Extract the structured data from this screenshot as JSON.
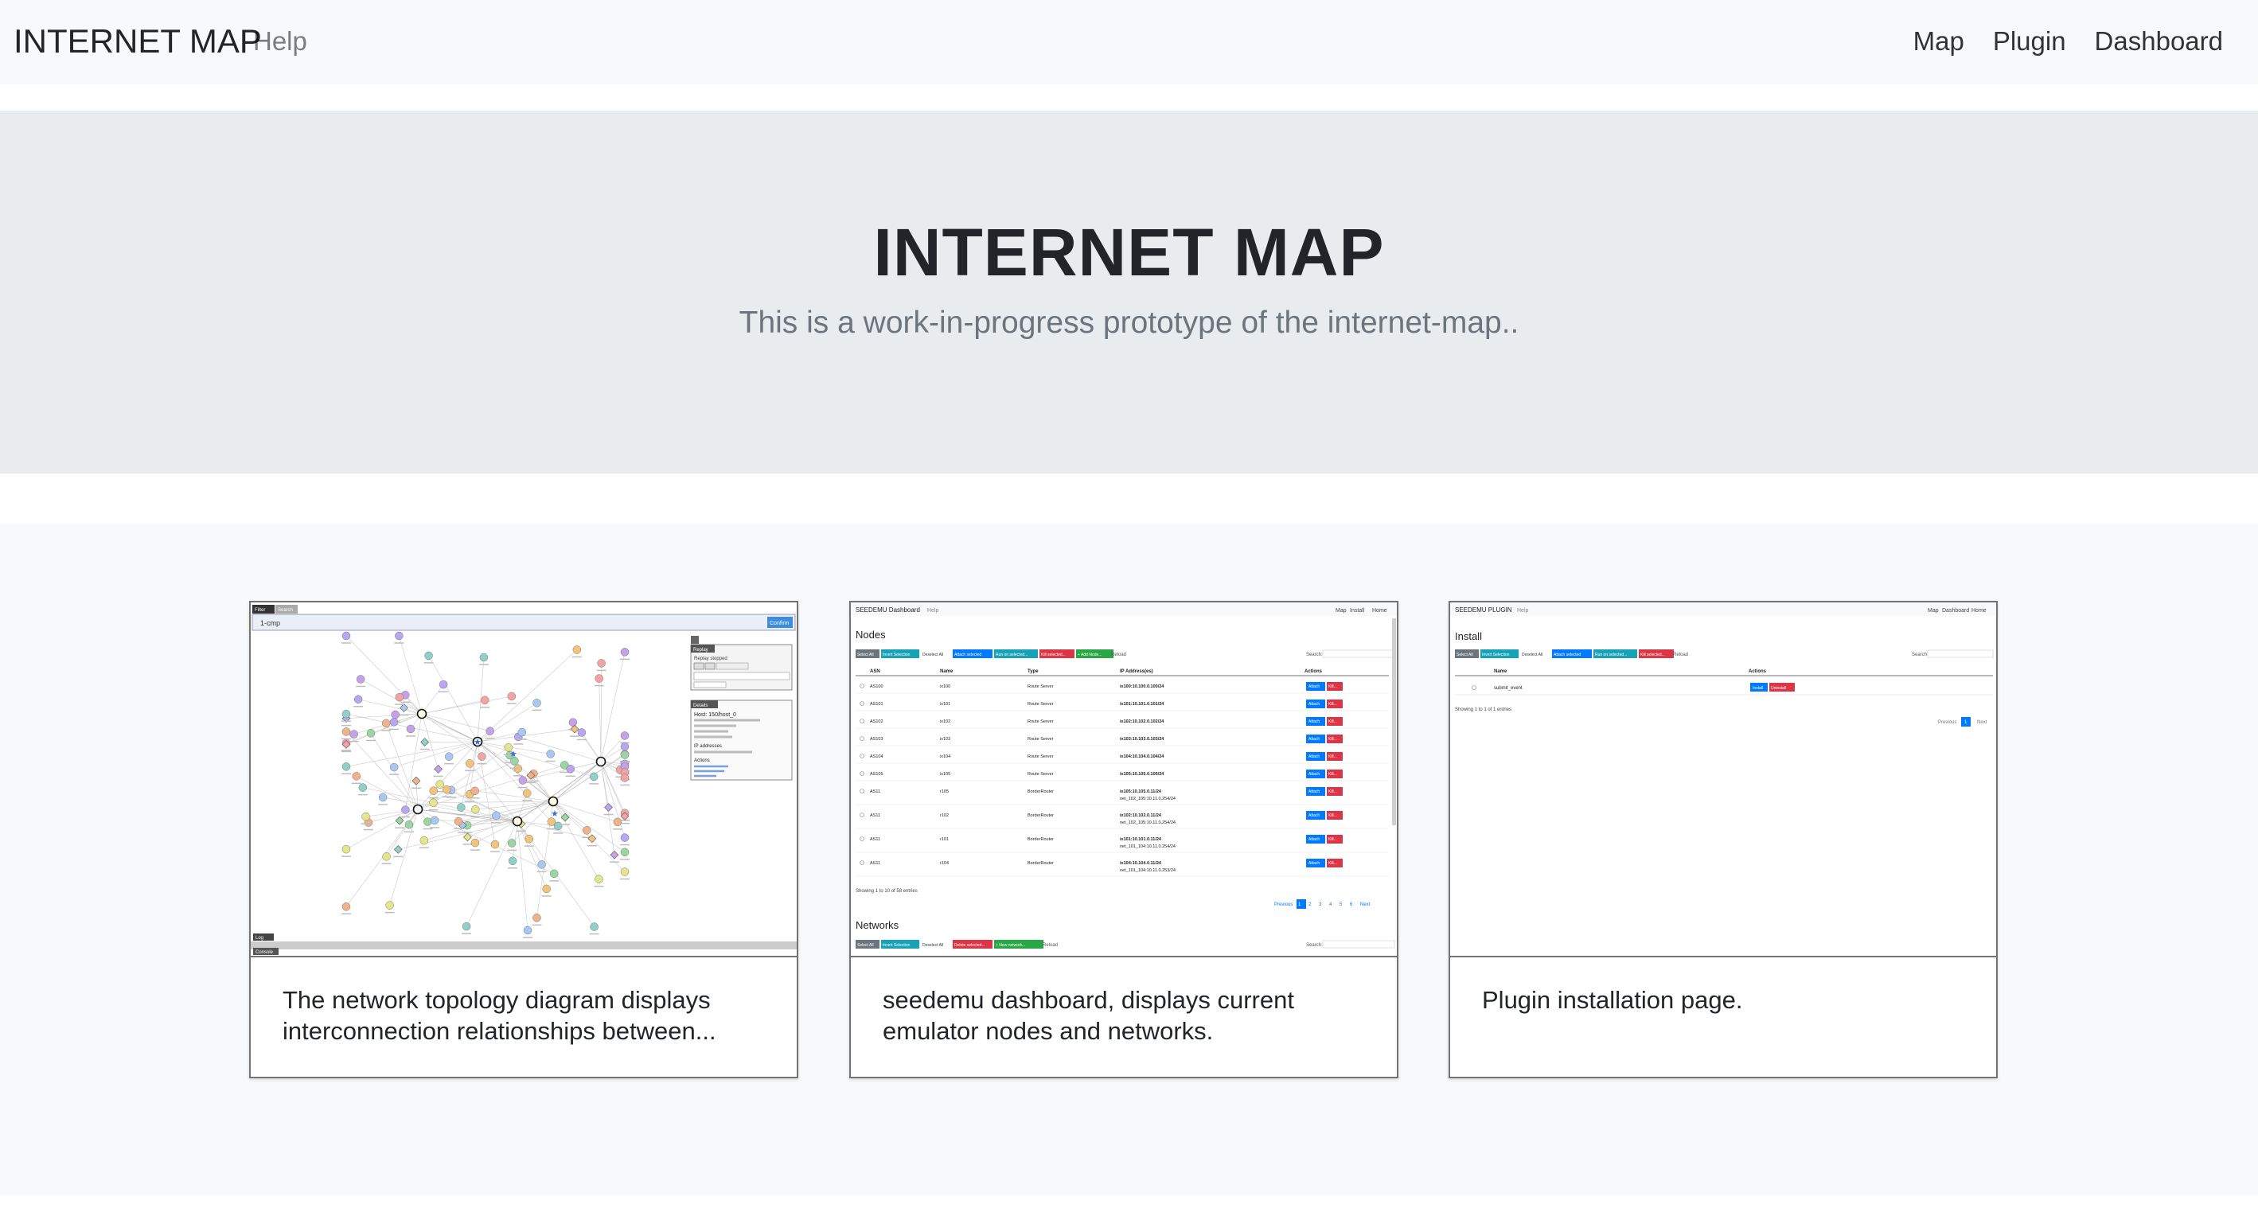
{
  "navbar": {
    "brand": "INTERNET MAP",
    "help": "Help",
    "links": [
      "Map",
      "Plugin",
      "Dashboard"
    ]
  },
  "jumbotron": {
    "title": "INTERNET MAP",
    "subtitle": "This is a work-in-progress prototype of the internet-map.."
  },
  "cards": [
    {
      "text": "The network topology diagram displays interconnection relationships between..."
    },
    {
      "text": "seedemu dashboard, displays current emulator nodes and networks."
    },
    {
      "text": "Plugin installation page."
    }
  ],
  "thumb_dashboard": {
    "header": "SEEDEMU Dashboard",
    "help": "Help",
    "nav": [
      "Map",
      "Install",
      "Home"
    ],
    "nodes_title": "Nodes",
    "networks_title": "Networks",
    "buttons": [
      "Select All",
      "Invert Selection",
      "Deselect All",
      "Attach selected",
      "Run on selected...",
      "Kill selected...",
      "+ Add Node..."
    ],
    "net_buttons": [
      "Select All",
      "Invert Selection",
      "Deselect All",
      "Delete selected...",
      "+ New network..."
    ],
    "reload": "Reload",
    "search": "Search:",
    "columns": [
      "ASN",
      "Name",
      "Type",
      "IP Address(es)",
      "Actions"
    ],
    "rows": [
      [
        "AS100",
        "ix100",
        "Route Server",
        "ix100:10.100.0.100/24"
      ],
      [
        "AS101",
        "ix101",
        "Route Server",
        "ix101:10.101.0.101/24"
      ],
      [
        "AS102",
        "ix102",
        "Route Server",
        "ix102:10.102.0.102/24"
      ],
      [
        "AS103",
        "ix103",
        "Route Server",
        "ix103:10.103.0.103/24"
      ],
      [
        "AS104",
        "ix104",
        "Route Server",
        "ix104:10.104.0.104/24"
      ],
      [
        "AS105",
        "ix105",
        "Route Server",
        "ix105:10.105.0.105/24"
      ],
      [
        "AS11",
        "r105",
        "BorderRouter",
        "ix105:10.105.0.11/24"
      ],
      [
        "AS11",
        "r102",
        "BorderRouter",
        "ix102:10.102.0.11/24"
      ],
      [
        "AS11",
        "r101",
        "BorderRouter",
        "ix101:10.101.0.11/24"
      ],
      [
        "AS11",
        "r104",
        "BorderRouter",
        "ix104:10.104.0.11/24"
      ]
    ],
    "row_sub": [
      "",
      "",
      "",
      "",
      "",
      "",
      "net_102_105:10.11.0.254/24",
      "net_102_105:10.11.0.254/24",
      "net_101_104:10.11.0.254/24",
      "net_101_104:10.11.0.253/24"
    ],
    "action_attach": "Attach",
    "action_kill": "Kill...",
    "footer": "Showing 1 to 10 of 58 entries",
    "pager": [
      "Previous",
      "1",
      "2",
      "3",
      "4",
      "5",
      "6",
      "Next"
    ]
  },
  "thumb_plugin": {
    "header": "SEEDEMU PLUGIN",
    "help": "Help",
    "nav": [
      "Map",
      "Dashboard",
      "Home"
    ],
    "title": "Install",
    "buttons": [
      "Select All",
      "Invert Selection",
      "Deselect All",
      "Attach selected",
      "Run on selected...",
      "Kill selected..."
    ],
    "reload": "Reload",
    "search": "Search:",
    "columns": [
      "Name",
      "Actions"
    ],
    "row_name": "submit_event",
    "install": "Install",
    "uninstall": "Uninstall",
    "footer": "Showing 1 to 1 of 1 entries",
    "pager": [
      "Previous",
      "1",
      "Next"
    ]
  },
  "thumb_map": {
    "search_value": "1-cmp",
    "filter_button": "Confirm",
    "tabs": [
      "Filter",
      "Search"
    ],
    "replay_title": "Replay",
    "replay_status": "Replay stopped",
    "details_title": "Details",
    "host_heading": "Host: 150/host_0",
    "addresses": "IP addresses",
    "actions": "Actions",
    "bottom_label": "Log",
    "bottom_tab": "Console"
  },
  "colors": {
    "navbar_bg": "#f8f9fa",
    "jumbotron_bg": "#e9ecef",
    "album_bg": "#f8f9fa",
    "primary": "#007bff",
    "danger": "#dc3545",
    "info": "#17a2b8",
    "success": "#28a745",
    "secondary": "#6c757d"
  }
}
